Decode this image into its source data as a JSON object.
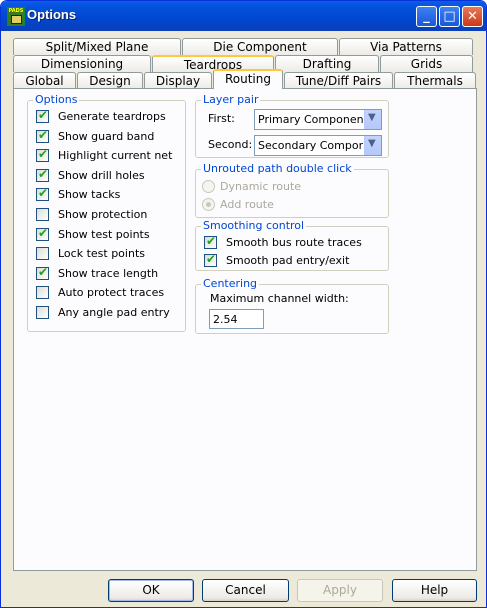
{
  "window": {
    "title": "Options",
    "app_icon_text": "PADS"
  },
  "tabs": {
    "row1": [
      "Split/Mixed Plane",
      "Die Component",
      "Via Patterns"
    ],
    "row2": [
      "Dimensioning",
      "Teardrops",
      "Drafting",
      "Grids"
    ],
    "row3": [
      "Global",
      "Design",
      "Display",
      "Routing",
      "Tune/Diff Pairs",
      "Thermals"
    ],
    "active": "Routing"
  },
  "options_group": {
    "title": "Options",
    "items": [
      {
        "label": "Generate teardrops",
        "checked": true
      },
      {
        "label": "Show guard band",
        "checked": true
      },
      {
        "label": "Highlight current net",
        "checked": true
      },
      {
        "label": "Show drill holes",
        "checked": true
      },
      {
        "label": "Show tacks",
        "checked": true
      },
      {
        "label": "Show protection",
        "checked": false
      },
      {
        "label": "Show test points",
        "checked": true
      },
      {
        "label": "Lock test points",
        "checked": false
      },
      {
        "label": "Show trace length",
        "checked": true
      },
      {
        "label": "Auto protect traces",
        "checked": false
      },
      {
        "label": "Any angle pad entry",
        "checked": false
      }
    ]
  },
  "layer_pair": {
    "title": "Layer pair",
    "first_label": "First:",
    "first_value": "Primary Component Si",
    "second_label": "Second:",
    "second_value": "Secondary Componer"
  },
  "unrouted": {
    "title": "Unrouted path double click",
    "options": [
      {
        "label": "Dynamic route",
        "selected": false
      },
      {
        "label": "Add route",
        "selected": true
      }
    ]
  },
  "smoothing": {
    "title": "Smoothing control",
    "items": [
      {
        "label": "Smooth bus route traces",
        "checked": true
      },
      {
        "label": "Smooth pad entry/exit",
        "checked": true
      }
    ]
  },
  "centering": {
    "title": "Centering",
    "label": "Maximum channel width:",
    "value": "2.54"
  },
  "buttons": {
    "ok": "OK",
    "cancel": "Cancel",
    "apply": "Apply",
    "help": "Help"
  }
}
